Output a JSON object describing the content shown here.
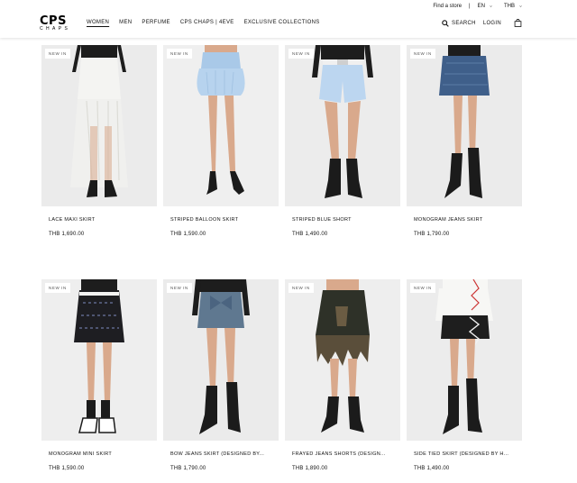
{
  "header": {
    "utility": {
      "store_label": "Find a store",
      "language": "EN",
      "currency": "THB"
    },
    "logo": {
      "line1": "CPS",
      "line2": "CHAPS"
    },
    "nav": [
      {
        "label": "WOMEN",
        "active": true
      },
      {
        "label": "MEN",
        "active": false
      },
      {
        "label": "PERFUME",
        "active": false
      },
      {
        "label": "CPS CHAPS | 4EVE",
        "active": false
      },
      {
        "label": "EXCLUSIVE COLLECTIONS",
        "active": false
      }
    ],
    "search_label": "SEARCH",
    "login_label": "LOGIN",
    "icons": {
      "search": "search-icon",
      "bag": "shopping-bag-icon"
    }
  },
  "products": [
    {
      "badge": "NEW IN",
      "name": "LACE MAXI SKIRT",
      "price": "THB 1,690.00"
    },
    {
      "badge": "NEW IN",
      "name": "STRIPED BALLOON SKIRT",
      "price": "THB 1,590.00"
    },
    {
      "badge": "NEW IN",
      "name": "STRIPED BLUE SHORT",
      "price": "THB 1,490.00"
    },
    {
      "badge": "NEW IN",
      "name": "MONOGRAM JEANS SKIRT",
      "price": "THB 1,790.00"
    },
    {
      "badge": "NEW IN",
      "name": "MONOGRAM MINI SKIRT",
      "price": "THB 1,590.00"
    },
    {
      "badge": "NEW IN",
      "name": "BOW JEANS SKIRT (DESIGNED BY...",
      "price": "THB 1,790.00"
    },
    {
      "badge": "NEW IN",
      "name": "FRAYED JEANS SHORTS (DESIGN...",
      "price": "THB 1,890.00"
    },
    {
      "badge": "NEW IN",
      "name": "SIDE TIED SKIRT (DESIGNED BY H...",
      "price": "THB 1,490.00"
    }
  ],
  "colors": {
    "photo_background": "#e9e9e9",
    "skin": "#d9a98c",
    "boots": "#1b1b1b"
  }
}
